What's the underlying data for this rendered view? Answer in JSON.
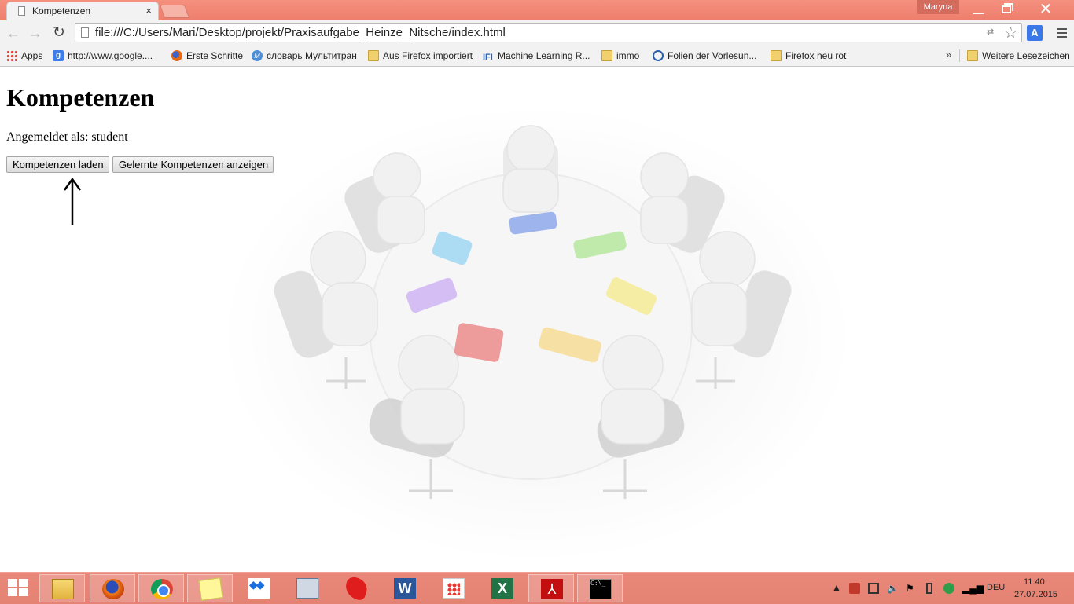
{
  "browser": {
    "tab_title": "Kompetenzen",
    "tab_close": "×",
    "user_badge": "Maryna",
    "url": "file:///C:/Users/Mari/Desktop/projekt/Praxisaufgabe_Heinze_Nitsche/index.html",
    "nav": {
      "back": "←",
      "forward": "→",
      "reload": "↻",
      "star": "☆",
      "ext": "A"
    },
    "window_close": "✕"
  },
  "bookmarks": [
    {
      "label": "Apps",
      "icon": "apps-grid-icon"
    },
    {
      "label": "http://www.google....",
      "icon": "google-icon"
    },
    {
      "label": "Erste Schritte",
      "icon": "firefox-icon"
    },
    {
      "label": "словарь Мультитран",
      "icon": "multitran-icon"
    },
    {
      "label": "Aus Firefox importiert",
      "icon": "folder-icon"
    },
    {
      "label": "Machine Learning R...",
      "icon": "ifi-icon"
    },
    {
      "label": "immo",
      "icon": "folder-icon"
    },
    {
      "label": "Folien der Vorlesun...",
      "icon": "folien-icon"
    },
    {
      "label": "Firefox neu rot",
      "icon": "folder-icon"
    },
    {
      "label": "Weitere Lesezeichen",
      "icon": "folder-icon"
    }
  ],
  "bookmarks_more": "»",
  "page": {
    "title": "Kompetenzen",
    "login_text": "Angemeldet als: student",
    "buttons": {
      "load": "Kompetenzen laden",
      "show": "Gelernte Kompetenzen anzeigen"
    }
  },
  "taskbar": {
    "apps": [
      "file-explorer-icon",
      "firefox-icon",
      "chrome-icon",
      "sticky-notes-icon",
      "dropbox-icon",
      "calculator-icon",
      "splat-icon",
      "word-icon",
      "app-grid-icon",
      "excel-icon",
      "acrobat-icon",
      "cmd-icon"
    ],
    "word_glyph": "W",
    "excel_glyph": "X",
    "pdf_glyph": "⅄",
    "cmd_glyph": "C:\\_",
    "tray_up": "▲",
    "language": "DEU",
    "time": "11:40",
    "date": "27.07.2015"
  },
  "colors": {
    "titlebar": "#ee7e6c",
    "taskbar": "#e48273",
    "puzzle": [
      "#7cc4f0",
      "#7c9de6",
      "#9ee07a",
      "#f5e56b",
      "#c79cf0",
      "#f2d27a",
      "#e06060"
    ]
  }
}
